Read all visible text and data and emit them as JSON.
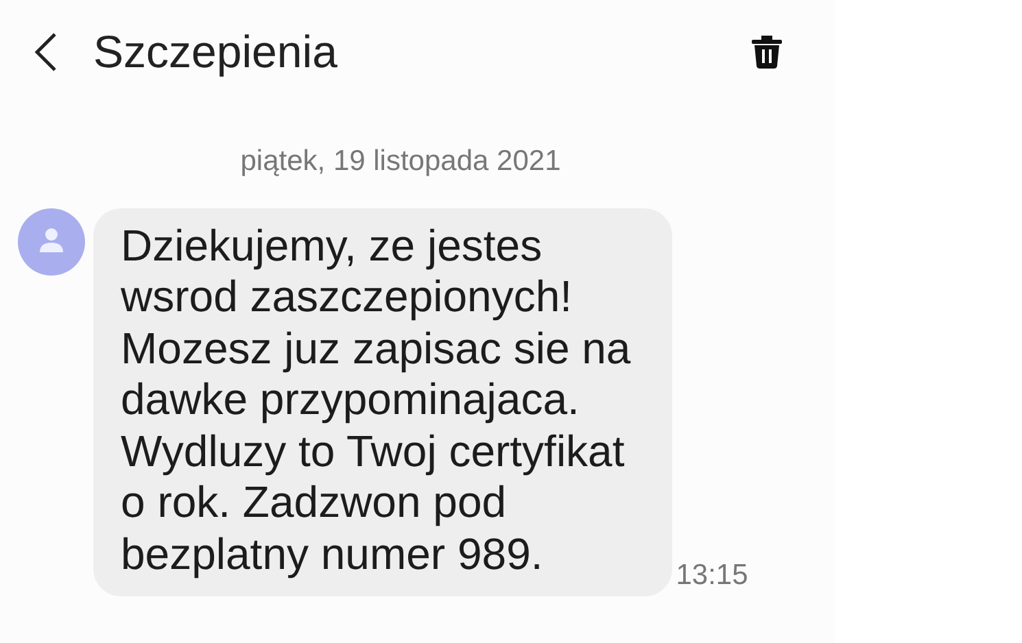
{
  "header": {
    "title": "Szczepienia"
  },
  "date_separator": "piątek, 19 listopada 2021",
  "messages": [
    {
      "kind": "incoming",
      "text": "Dziekujemy, ze jestes\nwsrod zaszczepionych!\nMozesz juz zapisac sie na\ndawke przypominajaca.\nWydluzy to Twoj certyfikat\no rok. Zadzwon pod\nbezplatny numer 989.",
      "time": "13:15"
    }
  ]
}
